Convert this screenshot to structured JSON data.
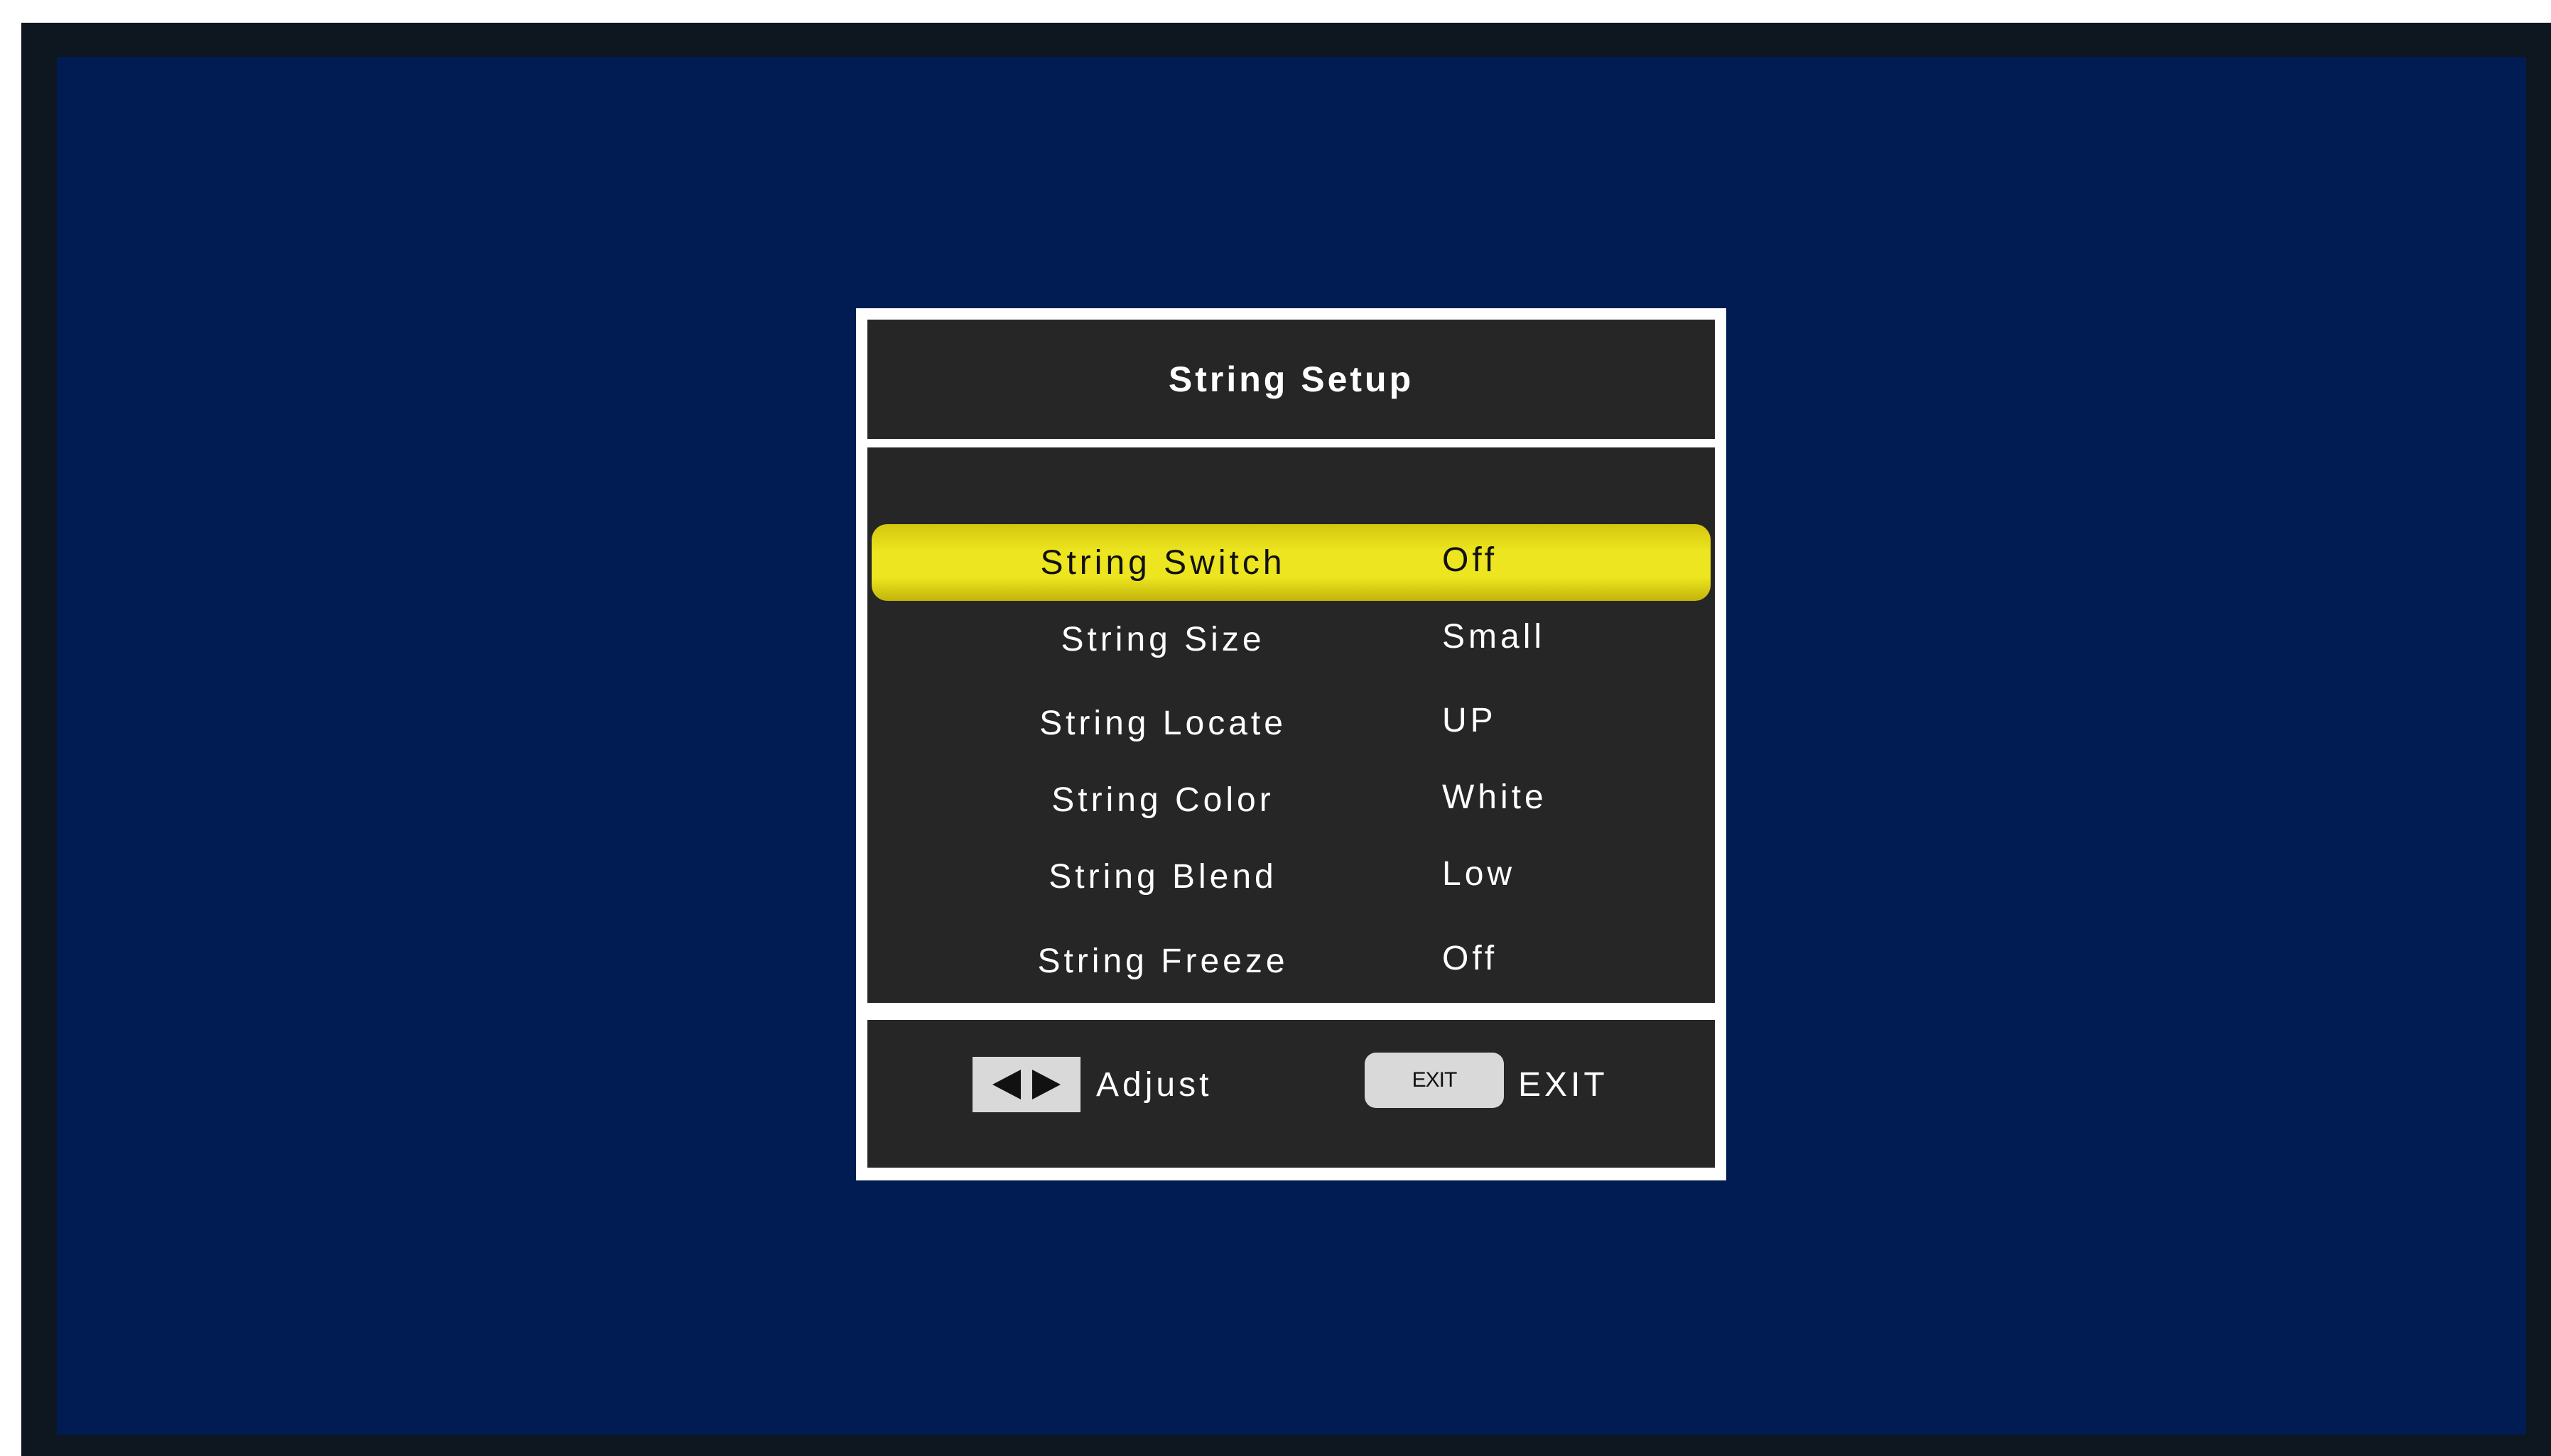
{
  "osd": {
    "title": "String Setup",
    "items": [
      {
        "label": "String Switch",
        "value": "Off",
        "selected": true
      },
      {
        "label": "String Size",
        "value": "Small",
        "selected": false
      },
      {
        "label": "String Locate",
        "value": "UP",
        "selected": false
      },
      {
        "label": "String Color",
        "value": "White",
        "selected": false
      },
      {
        "label": "String Blend",
        "value": "Low",
        "selected": false
      },
      {
        "label": "String Freeze",
        "value": "Off",
        "selected": false
      }
    ],
    "footer": {
      "adjust_icon": "left-right-arrows-icon",
      "adjust_label": "Adjust",
      "exit_key_label": "EXIT",
      "exit_label": "EXIT"
    }
  },
  "colors": {
    "screen_background": "#001c53",
    "bezel": "#0e1720",
    "panel": "#262626",
    "highlight": "#ece51f",
    "text": "#ffffff"
  }
}
